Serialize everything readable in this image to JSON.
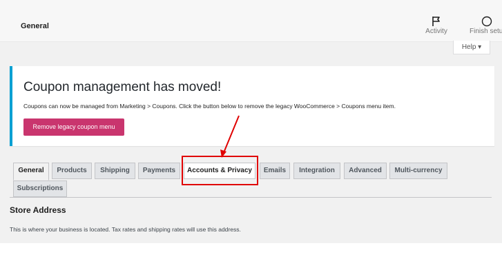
{
  "header": {
    "title": "General",
    "activity_label": "Activity",
    "finish_setup_label": "Finish setup"
  },
  "help": {
    "label": "Help ▾"
  },
  "notice": {
    "title": "Coupon management has moved!",
    "text": "Coupons can now be managed from Marketing > Coupons. Click the button below to remove the legacy WooCommerce > Coupons menu item.",
    "button_label": "Remove legacy coupon menu",
    "accent_color": "#00a0d2",
    "button_color": "#c9356e"
  },
  "tabs": [
    {
      "label": "General",
      "active": true
    },
    {
      "label": "Products"
    },
    {
      "label": "Shipping"
    },
    {
      "label": "Payments"
    },
    {
      "label": "Accounts & Privacy",
      "highlighted": true
    },
    {
      "label": "Emails"
    },
    {
      "label": "Integration"
    },
    {
      "label": "Advanced"
    },
    {
      "label": "Multi-currency"
    },
    {
      "label": "Subscriptions"
    }
  ],
  "section": {
    "title": "Store Address",
    "description": "This is where your business is located. Tax rates and shipping rates will use this address."
  },
  "annotation": {
    "color": "#e00000"
  }
}
